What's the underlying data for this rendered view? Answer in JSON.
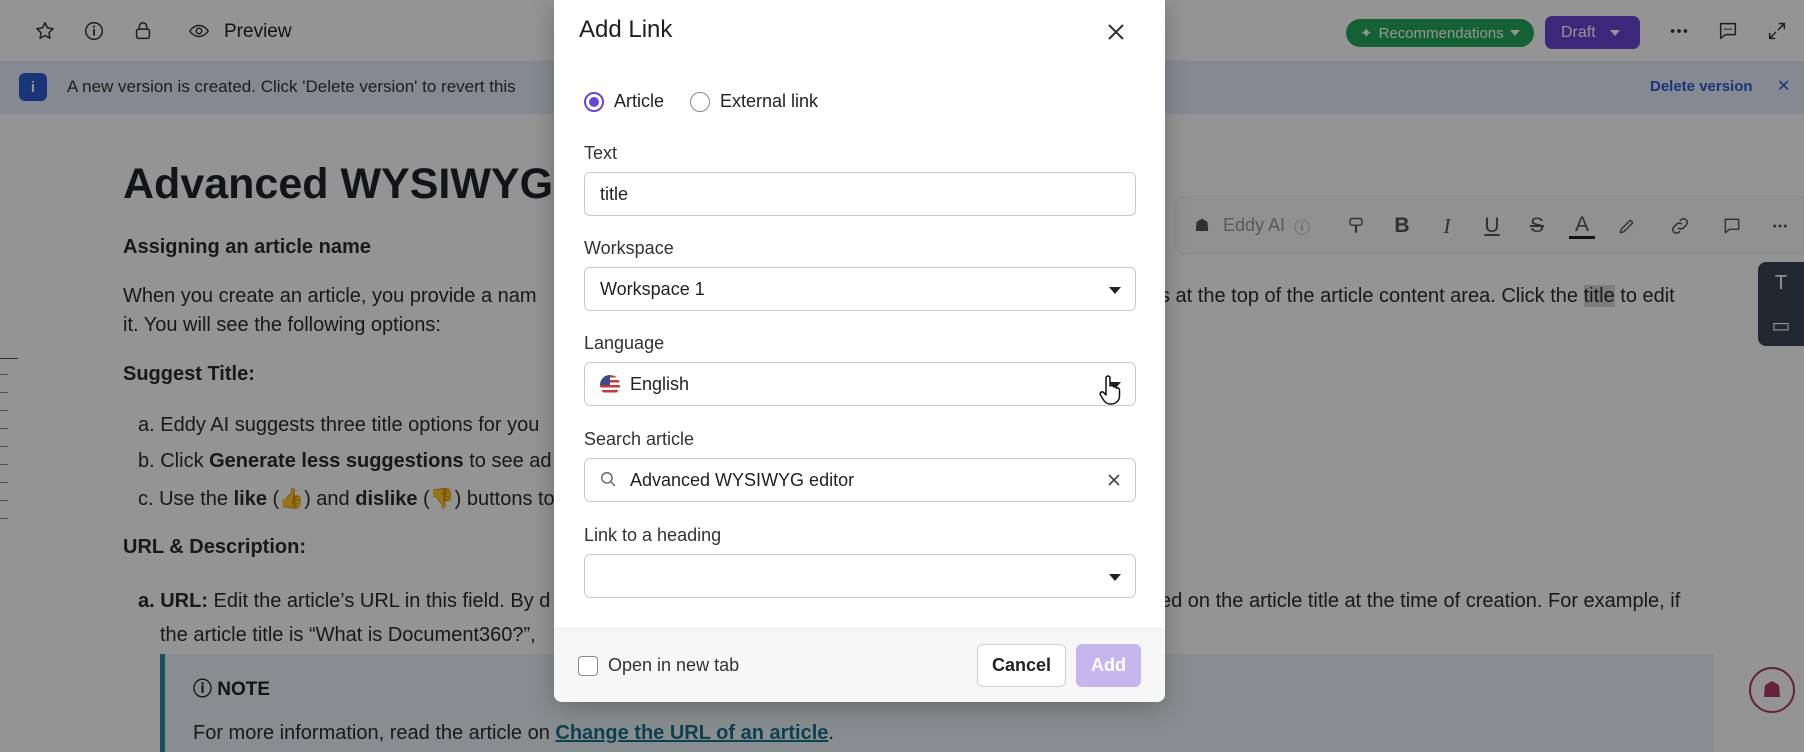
{
  "toolbar": {
    "preview_label": "Preview",
    "recommendations_label": "Recommendations",
    "draft_label": "Draft"
  },
  "banner": {
    "text": "A new version is created. Click 'Delete version' to revert this",
    "link": "Delete version"
  },
  "article": {
    "title": "Advanced WYSIWYG e",
    "assigning_heading": "Assigning an article name",
    "para1_a": "When you create an article, you provide a nam",
    "para1_b": "s at the top of the article content area. Click the ",
    "para1_highlight": "title",
    "para1_c": " to edit",
    "para1_line2": "it. You will see the following options:",
    "suggest_heading": "Suggest Title:",
    "list_a": "a. Eddy AI suggests three title options for you",
    "list_b_prefix": "b. Click ",
    "list_b_bold": "Generate less suggestions",
    "list_b_suffix": " to see ad",
    "list_c_prefix": "c. Use the ",
    "list_c_like": "like",
    "list_c_mid": " (👍) and ",
    "list_c_dislike": "dislike",
    "list_c_suffix": " (👎) buttons to",
    "url_heading": "URL & Description:",
    "url_item_bold": "a. URL:",
    "url_item_text": " Edit the article’s URL in this field. By d",
    "url_item_right": "ed on the article title at the time of creation. For example, if",
    "url_item_line2": "the article title is “What is Document360?”,",
    "note_title": "NOTE",
    "note_body_prefix": "For more information, read the article on ",
    "note_body_link": "Change the URL of an article",
    "note_body_suffix": "."
  },
  "editor_toolbar": {
    "eddy_label": "Eddy AI"
  },
  "modal": {
    "title": "Add Link",
    "radio_article": "Article",
    "radio_external": "External link",
    "selected_type": "Article",
    "text_label": "Text",
    "text_value": "title",
    "workspace_label": "Workspace",
    "workspace_value": "Workspace 1",
    "language_label": "Language",
    "language_value": "English",
    "search_label": "Search article",
    "search_value": "Advanced WYSIWYG editor",
    "heading_label": "Link to a heading",
    "heading_value": "",
    "open_new_tab_label": "Open in new tab",
    "open_new_tab_checked": false,
    "cancel_label": "Cancel",
    "add_label": "Add"
  },
  "colors": {
    "accent": "#6a44d4",
    "recommendations": "#22a85a",
    "banner_bg": "#e6eefc",
    "add_disabled": "#c5b7ee"
  }
}
